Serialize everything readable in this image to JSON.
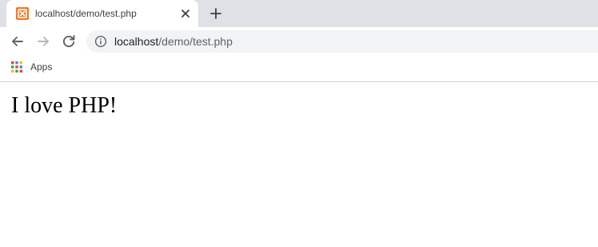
{
  "tab": {
    "title": "localhost/demo/test.php",
    "favicon": "xampp-icon",
    "close_icon": "close-icon"
  },
  "new_tab_icon": "plus-icon",
  "toolbar": {
    "back_icon": "arrow-left-icon",
    "forward_icon": "arrow-right-icon",
    "reload_icon": "reload-icon",
    "site_info_icon": "info-icon",
    "url_host": "localhost",
    "url_path": "/demo/test.php"
  },
  "bookmarks": {
    "apps_label": "Apps",
    "apps_icon": "apps-grid-icon"
  },
  "page": {
    "heading": "I love PHP!"
  },
  "colors": {
    "tab_strip": "#dee1e6",
    "omnibox": "#f1f3f4",
    "favicon": "#f07b22"
  }
}
